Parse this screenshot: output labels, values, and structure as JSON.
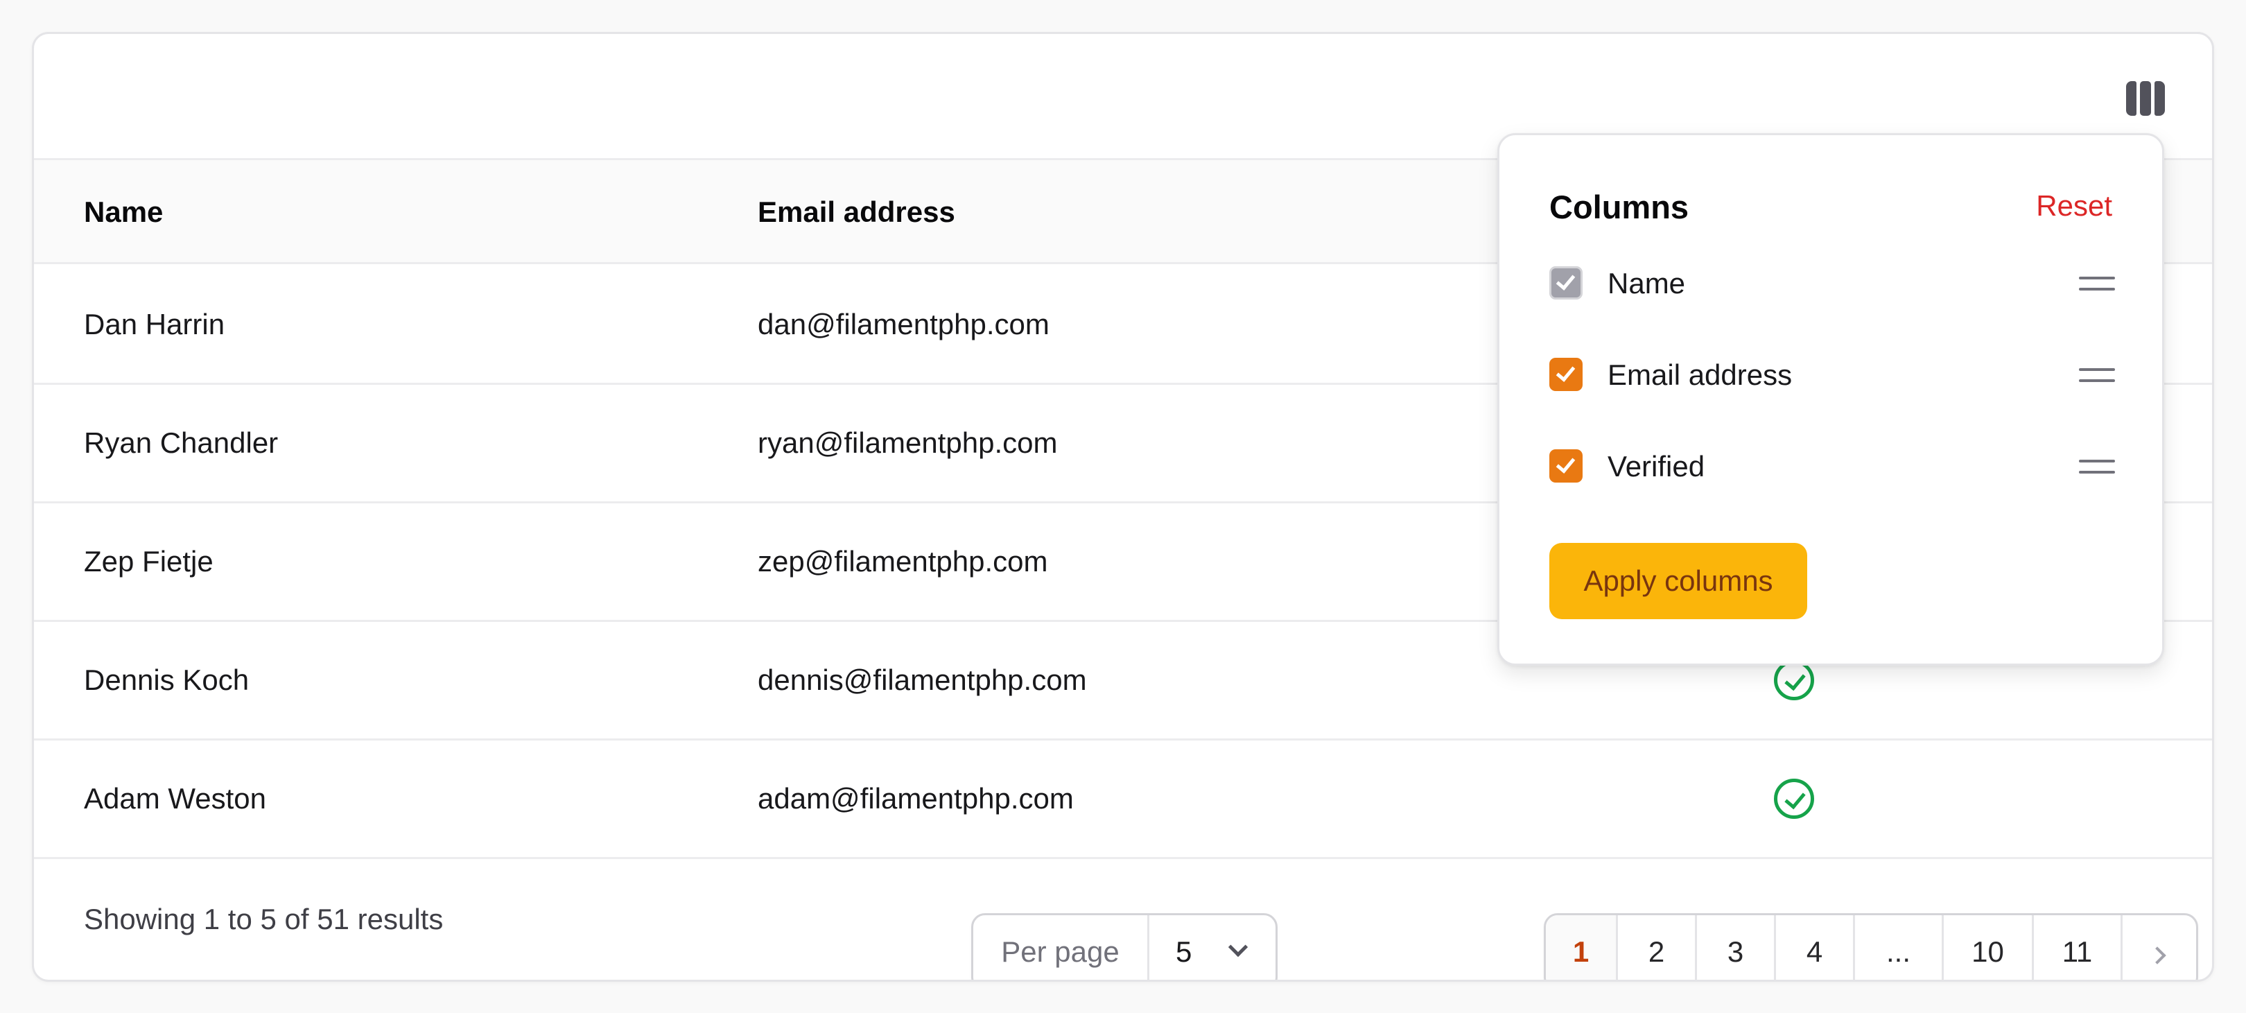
{
  "table": {
    "headers": {
      "name": "Name",
      "email": "Email address"
    },
    "rows": [
      {
        "name": "Dan Harrin",
        "email": "dan@filamentphp.com",
        "verified": true
      },
      {
        "name": "Ryan Chandler",
        "email": "ryan@filamentphp.com",
        "verified": true
      },
      {
        "name": "Zep Fietje",
        "email": "zep@filamentphp.com",
        "verified": true
      },
      {
        "name": "Dennis Koch",
        "email": "dennis@filamentphp.com",
        "verified": true
      },
      {
        "name": "Adam Weston",
        "email": "adam@filamentphp.com",
        "verified": true
      }
    ]
  },
  "footer": {
    "results": "Showing 1 to 5 of 51 results",
    "per_page_label": "Per page",
    "per_page_value": "5",
    "pages": [
      "1",
      "2",
      "3",
      "4",
      "...",
      "10",
      "11"
    ],
    "active_page": "1"
  },
  "column_manager": {
    "title": "Columns",
    "reset": "Reset",
    "items": [
      {
        "label": "Name",
        "checked": true,
        "disabled": true
      },
      {
        "label": "Email address",
        "checked": true,
        "disabled": false
      },
      {
        "label": "Verified",
        "checked": true,
        "disabled": false
      }
    ],
    "apply": "Apply columns"
  },
  "colors": {
    "accent": "#e97912",
    "apply_button": "#fbb50a",
    "verified": "#16a34a",
    "reset": "#dc2626"
  },
  "icons": [
    "columns-icon",
    "check-circle-icon",
    "chevron-down-icon",
    "chevron-right-icon",
    "drag-handle-icon"
  ]
}
